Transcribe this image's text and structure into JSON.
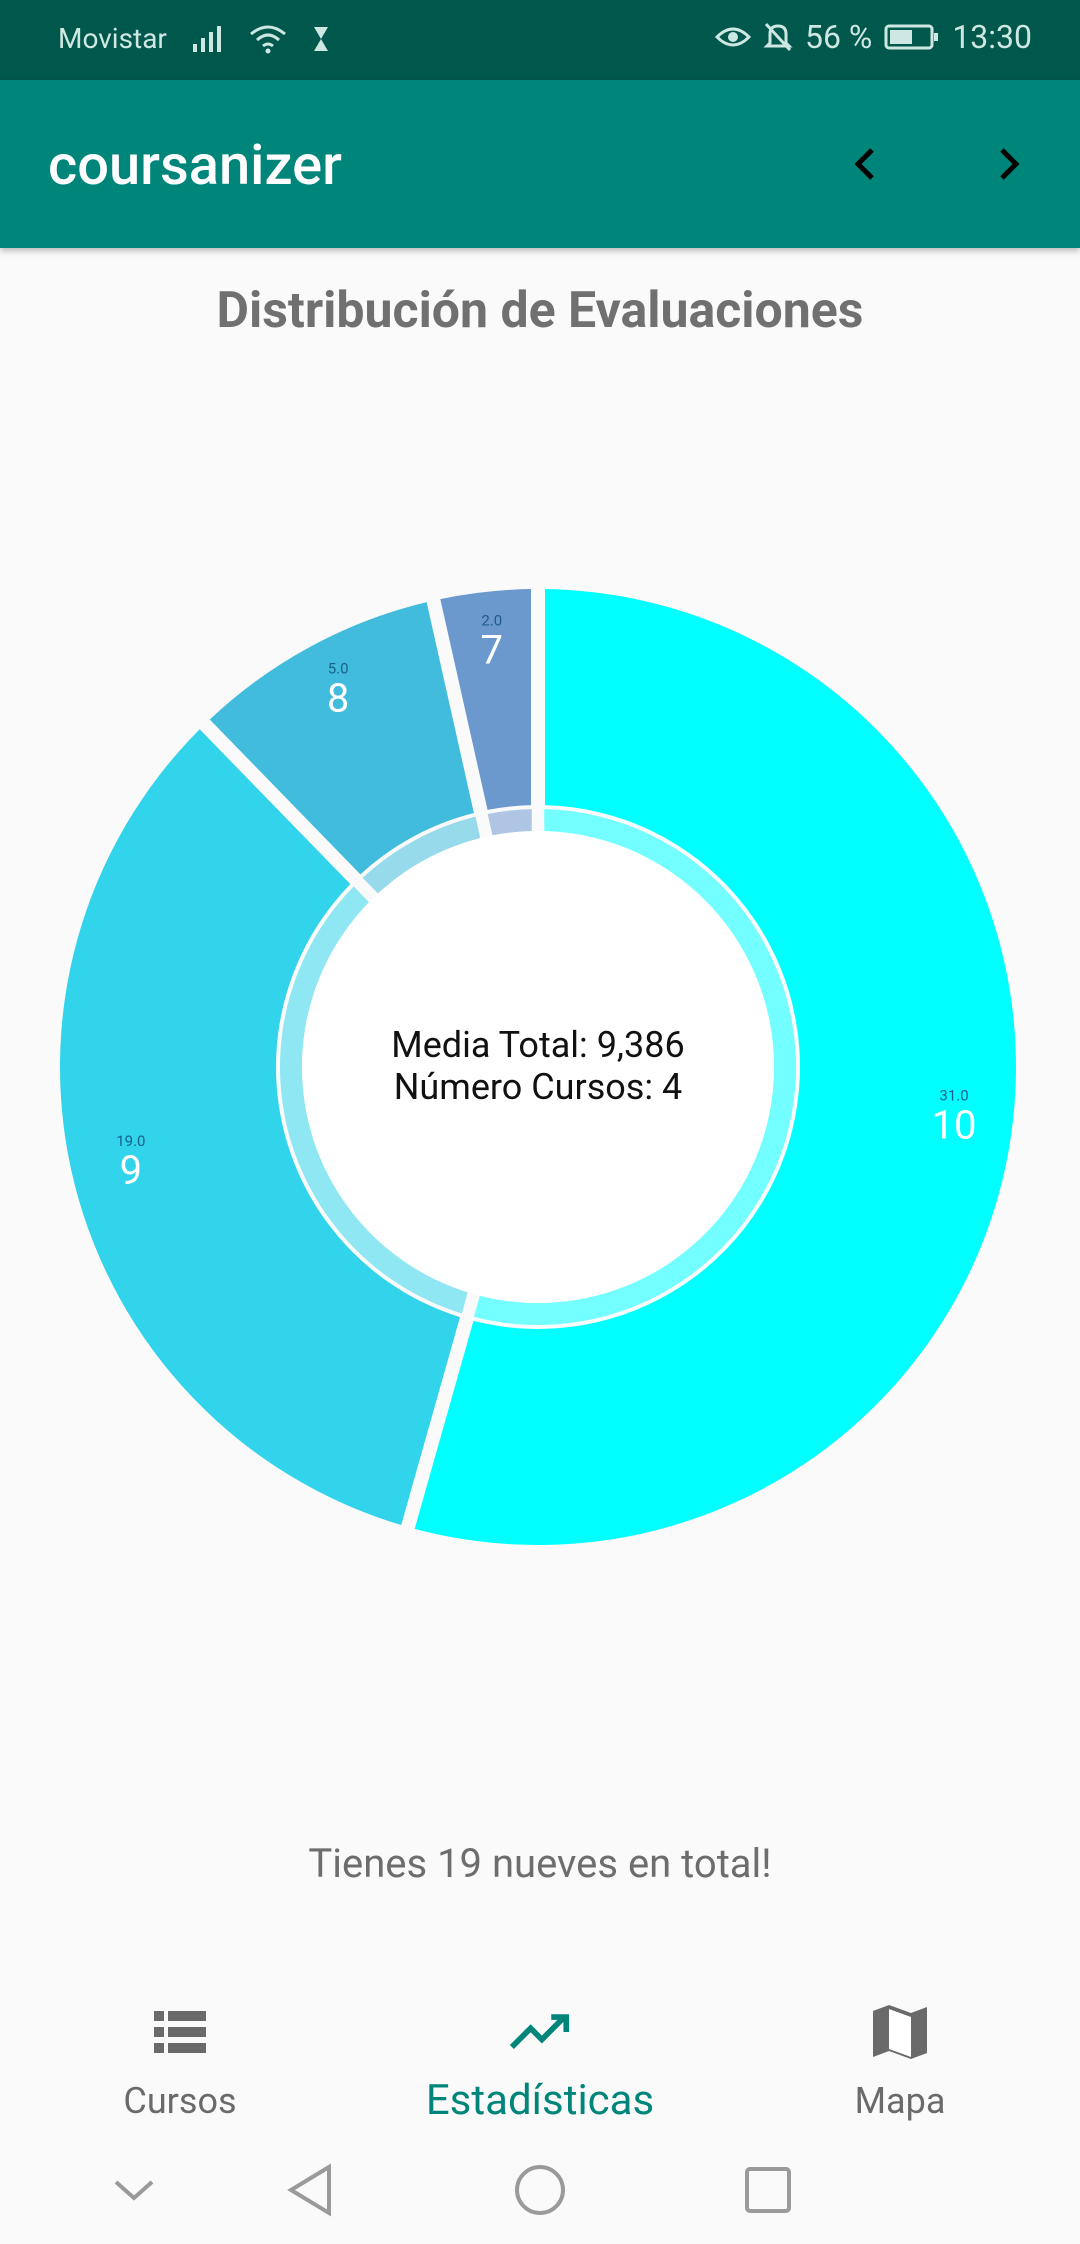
{
  "status_bar": {
    "carrier": "Movistar",
    "battery_percent": "56 %",
    "time": "13:30"
  },
  "app_bar": {
    "title": "coursanizer"
  },
  "chart_title": "Distribución de Evaluaciones",
  "chart_data": {
    "type": "pie",
    "title": "Distribución de Evaluaciones",
    "slices": [
      {
        "label": "10",
        "count": "31.0",
        "value": 31,
        "color": "#00ffff"
      },
      {
        "label": "9",
        "count": "19.0",
        "value": 19,
        "color": "#31d4ea"
      },
      {
        "label": "8",
        "count": "5.0",
        "value": 5,
        "color": "#42bcdc"
      },
      {
        "label": "7",
        "count": "2.0",
        "value": 2,
        "color": "#6b98cd"
      }
    ],
    "center_line1": "Media Total: 9,386",
    "center_line2": "Número Cursos: 4"
  },
  "summary": "Tienes 19 nueves en total!",
  "bottom_nav": {
    "items": [
      {
        "label": "Cursos",
        "icon": "list-icon",
        "active": false
      },
      {
        "label": "Estadísticas",
        "icon": "trending-up-icon",
        "active": true
      },
      {
        "label": "Mapa",
        "icon": "map-icon",
        "active": false
      }
    ]
  },
  "colors": {
    "status_bar": "#00574b",
    "primary": "#00857a"
  }
}
